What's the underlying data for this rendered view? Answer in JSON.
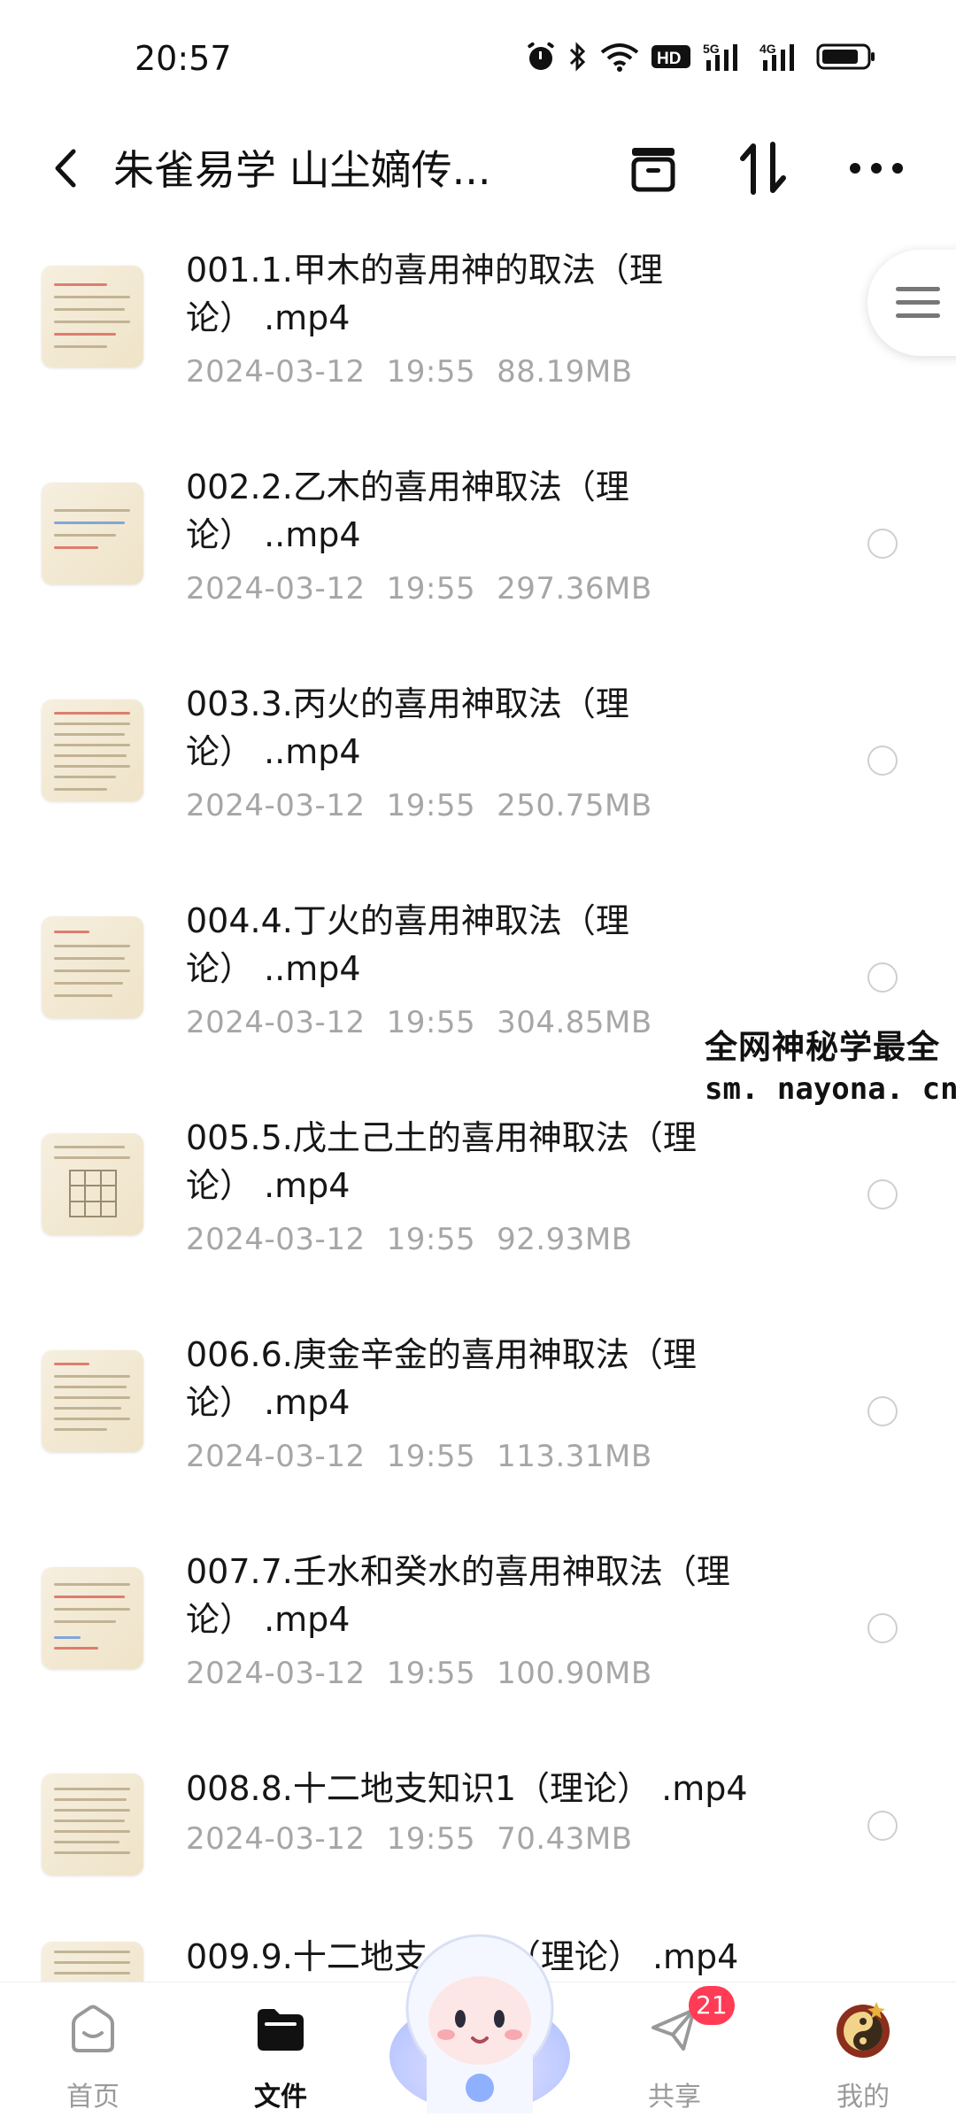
{
  "status_bar": {
    "time": "20:57",
    "icons": [
      "alarm-icon",
      "bluetooth-icon",
      "wifi-icon",
      "hd-icon",
      "signal-5g-icon",
      "signal-4g-icon",
      "battery-icon"
    ],
    "hd_text": "HD",
    "net1": "5G",
    "net2": "4G"
  },
  "header": {
    "title": "朱雀易学 山尘嫡传...",
    "icons": [
      "back-icon",
      "archive-icon",
      "sort-icon",
      "more-icon"
    ]
  },
  "files": [
    {
      "line1": "001.1.甲木的喜用神的取法（理",
      "line2": "论） .mp4",
      "date": "2024-03-12",
      "time": "19:55",
      "size": "88.19MB"
    },
    {
      "line1": "002.2.乙木的喜用神取法（理",
      "line2": "论） ..mp4",
      "date": "2024-03-12",
      "time": "19:55",
      "size": "297.36MB"
    },
    {
      "line1": "003.3.丙火的喜用神取法（理",
      "line2": "论） ..mp4",
      "date": "2024-03-12",
      "time": "19:55",
      "size": "250.75MB"
    },
    {
      "line1": "004.4.丁火的喜用神取法（理",
      "line2": "论） ..mp4",
      "date": "2024-03-12",
      "time": "19:55",
      "size": "304.85MB"
    },
    {
      "line1": "005.5.戊土己土的喜用神取法（理",
      "line2": "论） .mp4",
      "date": "2024-03-12",
      "time": "19:55",
      "size": "92.93MB"
    },
    {
      "line1": "006.6.庚金辛金的喜用神取法（理",
      "line2": "论） .mp4",
      "date": "2024-03-12",
      "time": "19:55",
      "size": "113.31MB"
    },
    {
      "line1": "007.7.壬水和癸水的喜用神取法（理",
      "line2": "论） .mp4",
      "date": "2024-03-12",
      "time": "19:55",
      "size": "100.90MB"
    },
    {
      "line1": "008.8.十二地支知识1（理论） .mp4",
      "line2": "",
      "date": "2024-03-12",
      "time": "19:55",
      "size": "70.43MB"
    },
    {
      "line1": "009.9.十二地支",
      "line2": "",
      "date": "",
      "time": "",
      "size": ""
    }
  ],
  "file9_tail": "（理论） .mp4",
  "watermark": {
    "line1": "全网神秘学最全",
    "line2": "sm. nayona. cn"
  },
  "bottom_nav": [
    {
      "label": "首页",
      "icon": "home-icon",
      "active": false
    },
    {
      "label": "文件",
      "icon": "folder-icon",
      "active": true
    },
    {
      "label": "共享",
      "icon": "share-icon",
      "active": false,
      "badge": "21"
    },
    {
      "label": "我的",
      "icon": "profile-avatar-icon",
      "active": false
    }
  ],
  "colors": {
    "accent": "#ff3b55",
    "meta_text": "#a6a6a6",
    "thumb_bg": "#f3ead6"
  }
}
